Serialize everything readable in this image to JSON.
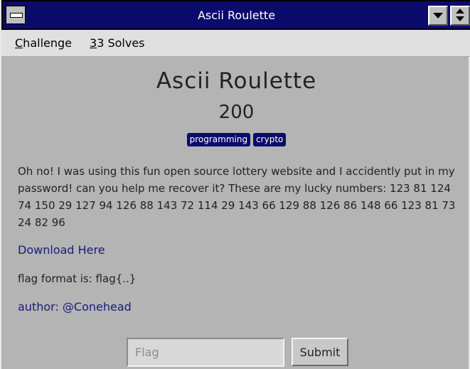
{
  "window": {
    "title": "Ascii Roulette",
    "colors": {
      "titlebar": "#0b0b6c",
      "background": "#b4b4b4",
      "menubar": "#e0e0e0",
      "tag": "#0b0b6c",
      "link": "#1a1a7a"
    }
  },
  "menu": {
    "challenge": {
      "accel": "C",
      "rest": "hallenge"
    },
    "solves": {
      "accel": "3",
      "rest": "3 Solves"
    }
  },
  "challenge": {
    "name": "Ascii Roulette",
    "points": "200",
    "tags": [
      "programming",
      "crypto"
    ],
    "description": "Oh no! I was using this fun open source lottery website and I accidently put in my password! can you help me recover it? These are my lucky numbers: 123 81 124 74 150 29 127 94 126 88 143 72 114 29 143 66 129 88 126 86 148 66 123 81 73 24 82 96",
    "download_label": "Download Here",
    "flag_format": "flag format is: flag{..}",
    "author": "author: @Conehead"
  },
  "form": {
    "flag_placeholder": "Flag",
    "flag_value": "",
    "submit_label": "Submit"
  },
  "icons": {
    "system_menu": "system-menu-icon",
    "minimize": "triangle-down-icon",
    "maximize": "up-down-arrows-icon"
  }
}
